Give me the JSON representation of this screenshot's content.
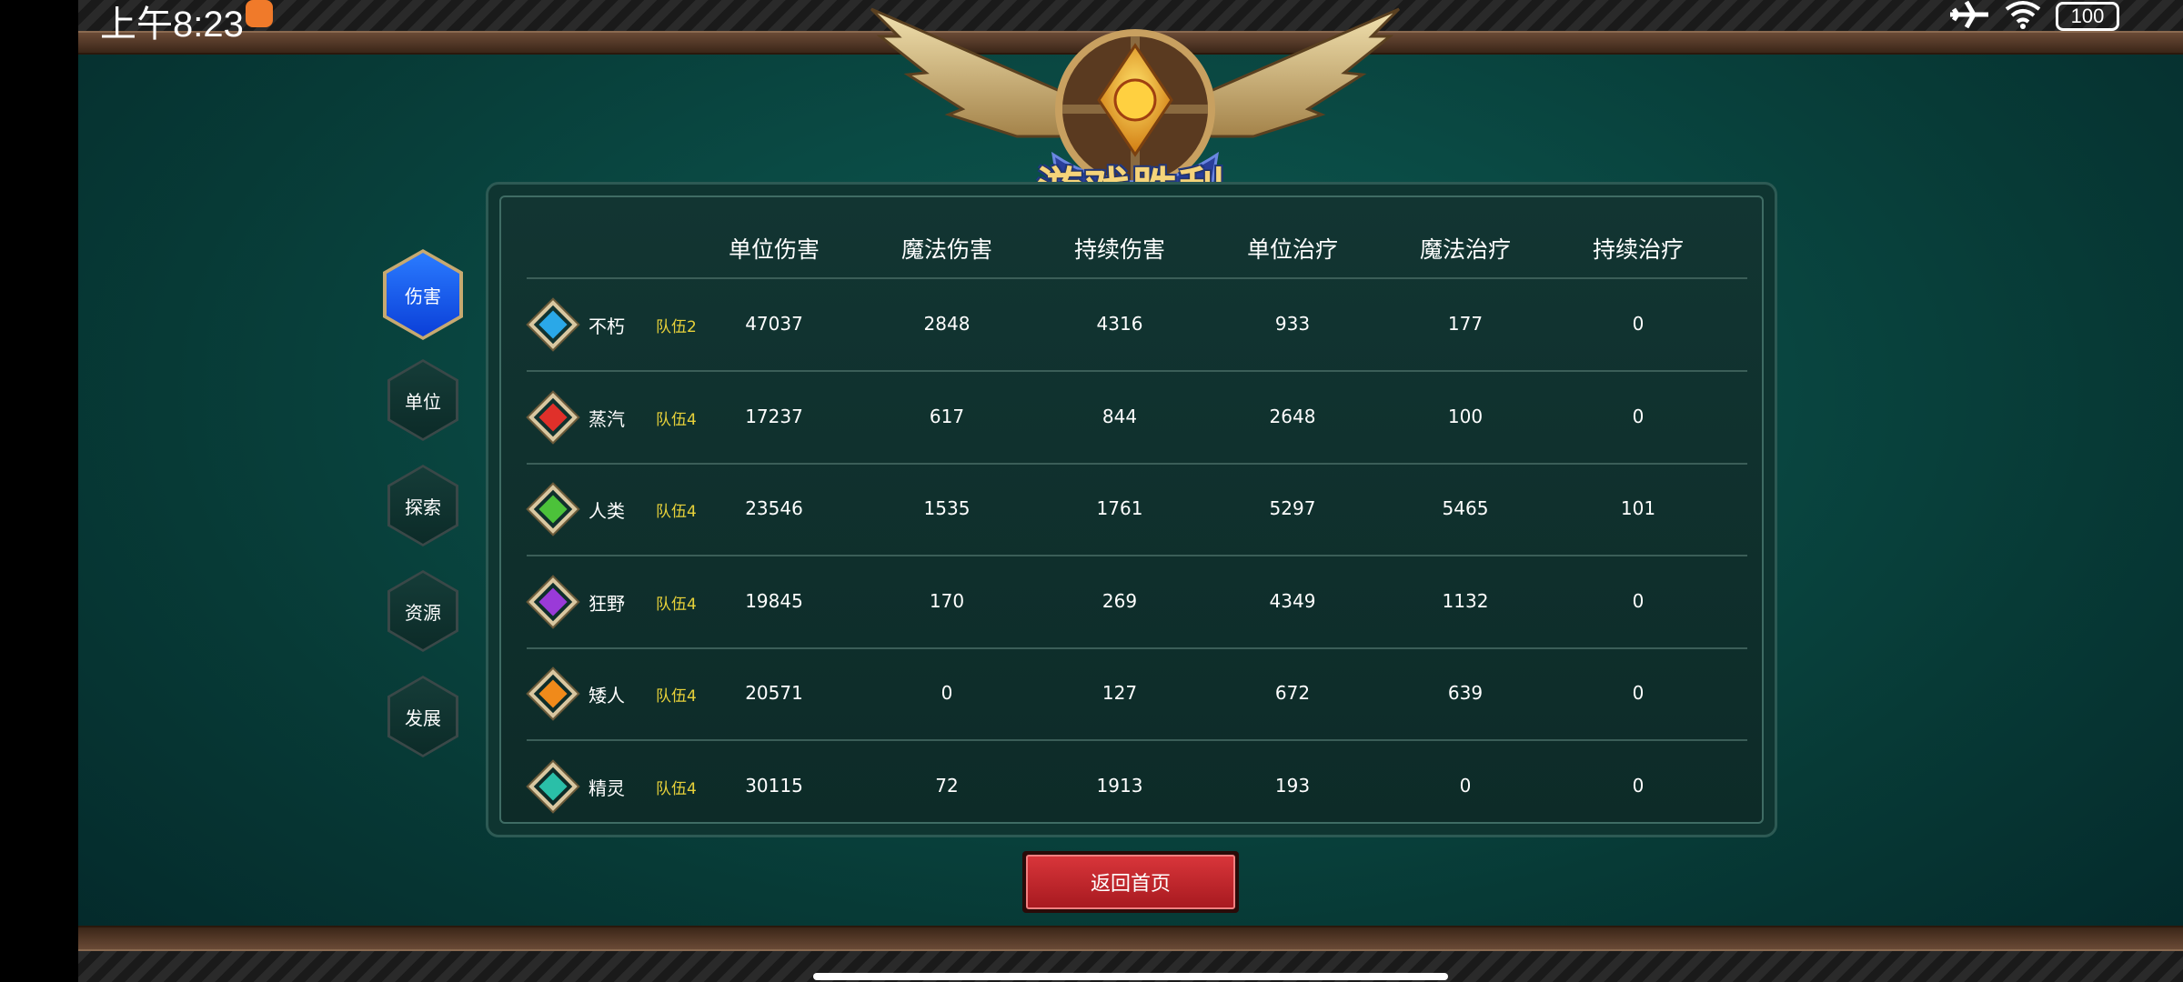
{
  "status_bar": {
    "time": "上午8:23",
    "battery": "100"
  },
  "banner": {
    "title": "游戏胜利"
  },
  "tabs": [
    {
      "label": "伤害",
      "active": true
    },
    {
      "label": "单位",
      "active": false
    },
    {
      "label": "探索",
      "active": false
    },
    {
      "label": "资源",
      "active": false
    },
    {
      "label": "发展",
      "active": false
    }
  ],
  "table": {
    "columns": [
      "单位伤害",
      "魔法伤害",
      "持续伤害",
      "单位治疗",
      "魔法治疗",
      "持续治疗"
    ],
    "rows": [
      {
        "gem_color": "#2aa8e8",
        "name": "不朽",
        "team": "队伍2",
        "values": [
          "47037",
          "2848",
          "4316",
          "933",
          "177",
          "0"
        ]
      },
      {
        "gem_color": "#e0302a",
        "name": "蒸汽",
        "team": "队伍4",
        "values": [
          "17237",
          "617",
          "844",
          "2648",
          "100",
          "0"
        ]
      },
      {
        "gem_color": "#4cc23a",
        "name": "人类",
        "team": "队伍4",
        "values": [
          "23546",
          "1535",
          "1761",
          "5297",
          "5465",
          "101"
        ]
      },
      {
        "gem_color": "#9a3ad8",
        "name": "狂野",
        "team": "队伍4",
        "values": [
          "19845",
          "170",
          "269",
          "4349",
          "1132",
          "0"
        ]
      },
      {
        "gem_color": "#f08a1a",
        "name": "矮人",
        "team": "队伍4",
        "values": [
          "20571",
          "0",
          "127",
          "672",
          "639",
          "0"
        ]
      },
      {
        "gem_color": "#2abfa8",
        "name": "精灵",
        "team": "队伍4",
        "values": [
          "30115",
          "72",
          "1913",
          "193",
          "0",
          "0"
        ]
      }
    ]
  },
  "return_button": {
    "label": "返回首页"
  }
}
